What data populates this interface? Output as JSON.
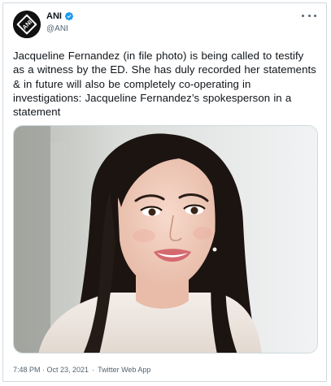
{
  "tweet": {
    "author": {
      "name": "ANI",
      "handle": "@ANI",
      "avatar_text": "ANI",
      "verified": true
    },
    "text": "Jacqueline Fernandez (in file photo) is being called to testify as a witness by the ED. She has duly recorded her statements & in future will also be completely co-operating in investigations: Jacqueline Fernandez’s spokesperson in a statement",
    "media": {
      "type": "photo"
    },
    "timestamp": "7:48 PM · Oct 23, 2021",
    "separator": "·",
    "source": "Twitter Web App"
  },
  "colors": {
    "text": "#0f1419",
    "secondary": "#536471",
    "border": "#cfd9de",
    "verified": "#1d9bf0"
  }
}
